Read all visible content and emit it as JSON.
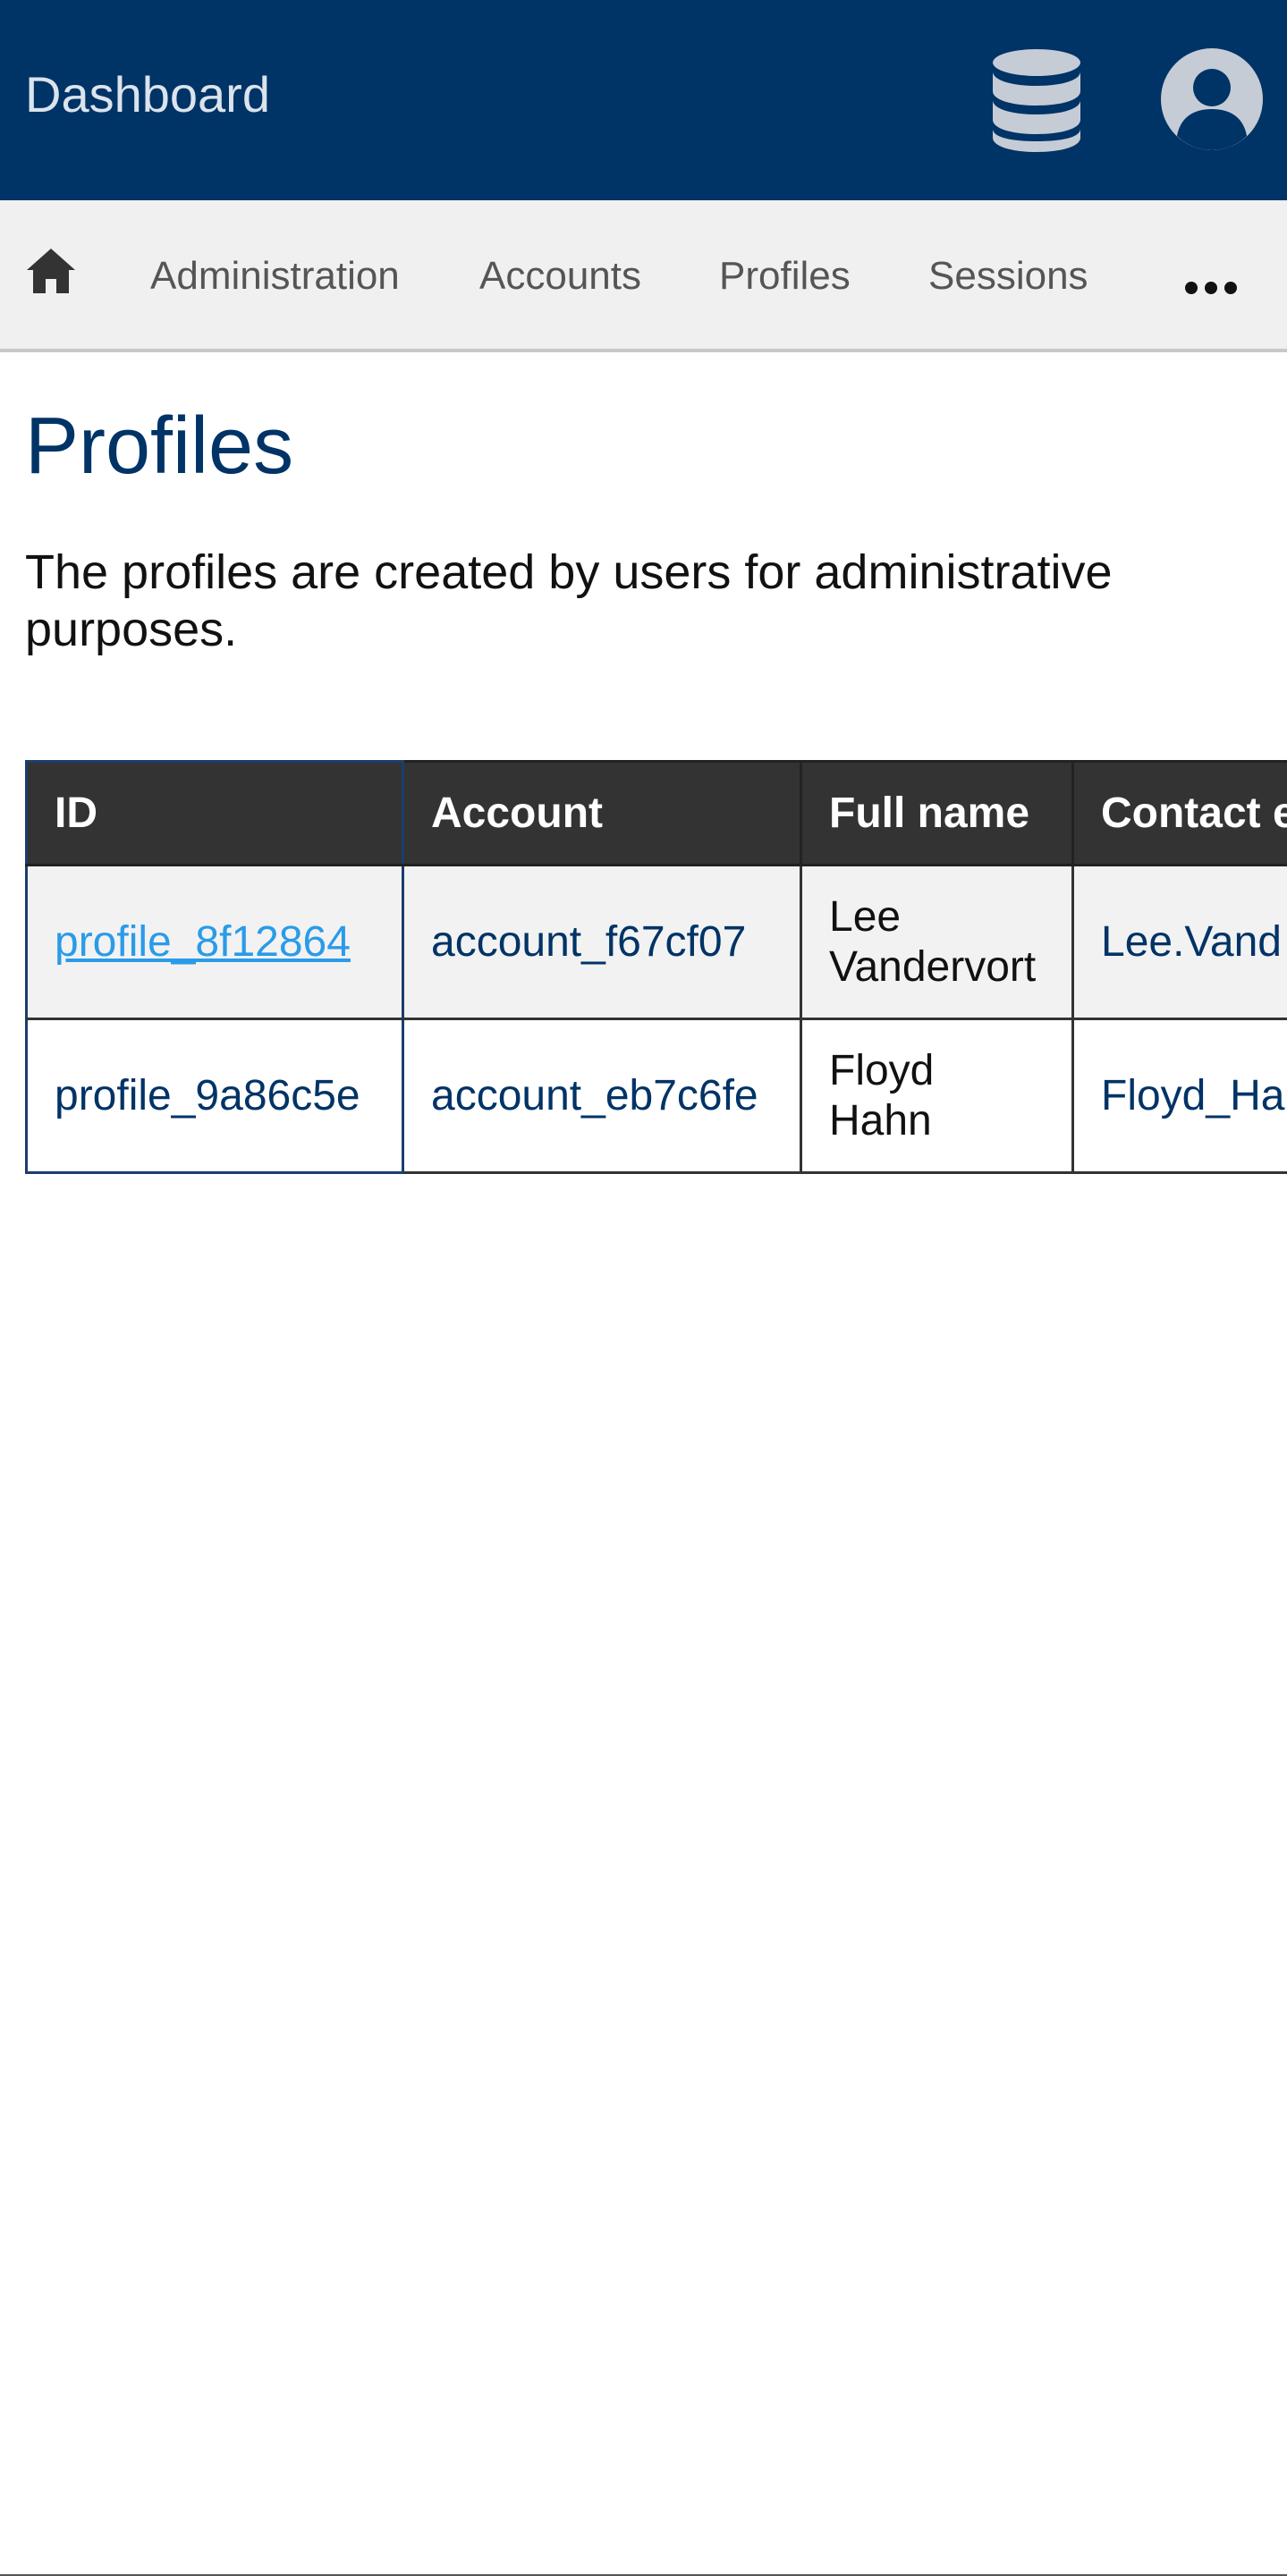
{
  "header": {
    "title": "Dashboard",
    "icons": {
      "database": "database-icon",
      "account": "user-circle-icon"
    },
    "colors": {
      "bar": "#003366",
      "icon": "#c5ccd6"
    }
  },
  "nav": {
    "home_icon": "home-icon",
    "items": [
      {
        "label": "Administration"
      },
      {
        "label": "Accounts"
      },
      {
        "label": "Profiles"
      },
      {
        "label": "Sessions"
      }
    ],
    "more_icon": "more-horizontal-icon"
  },
  "main": {
    "title": "Profiles",
    "description": "The profiles are created by users for administrative purposes.",
    "table": {
      "headers": [
        "ID",
        "Account",
        "Full name",
        "Contact e"
      ],
      "rows": [
        {
          "id": "profile_8f12864",
          "account": "account_f67cf07",
          "full_name": "Lee Vandervort",
          "contact": "Lee.Vand"
        },
        {
          "id": "profile_9a86c5e",
          "account": "account_eb7c6fe",
          "full_name": "Floyd Hahn",
          "contact": "Floyd_Ha"
        }
      ]
    }
  }
}
